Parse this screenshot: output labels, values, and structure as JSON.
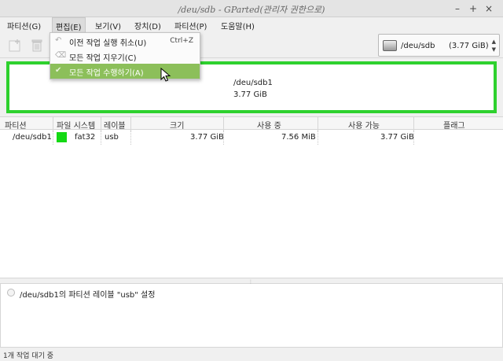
{
  "window": {
    "title": "/deu/sdb - GParted(관리자 권한으로)",
    "minimize": "–",
    "maximize": "+",
    "close": "×"
  },
  "menubar": {
    "items": [
      {
        "label": "파티션(G)"
      },
      {
        "label": "편집(E)"
      },
      {
        "label": "보기(V)"
      },
      {
        "label": "장치(D)"
      },
      {
        "label": "파티션(P)"
      },
      {
        "label": "도움말(H)"
      }
    ]
  },
  "edit_menu": {
    "items": [
      {
        "label": "이전 작업 실행 취소(U)",
        "shortcut": "Ctrl+Z",
        "icon": "undo-icon"
      },
      {
        "label": "모든 작업 지우기(C)",
        "shortcut": "",
        "icon": "clear-icon"
      },
      {
        "label": "모든 작업 수행하기(A)",
        "shortcut": "",
        "icon": "apply-check-icon"
      }
    ]
  },
  "device_selector": {
    "device": "/deu/sdb",
    "size": "(3.77 GiB)"
  },
  "graph": {
    "partition": "/deu/sdb1",
    "size": "3.77 GiB",
    "border_color": "#2ed12e"
  },
  "table": {
    "headers": [
      "파티션",
      "파일 시스템",
      "레이블",
      "크기",
      "사용 중",
      "사용 가능",
      "플래그"
    ],
    "rows": [
      {
        "partition": "/deu/sdb1",
        "filesystem": "fat32",
        "fs_color": "#14d914",
        "label": "usb",
        "size": "3.77 GiB",
        "used": "7.56 MiB",
        "unused": "3.77 GiB",
        "flags": ""
      }
    ]
  },
  "operations": {
    "items": [
      {
        "text": "/deu/sdb1의 파티션 레이블 \"usb\" 설정"
      }
    ]
  },
  "status": {
    "text": "1개 작업 대기 중"
  },
  "colors": {
    "highlight": "#8cbf5a",
    "fat32": "#14d914"
  }
}
